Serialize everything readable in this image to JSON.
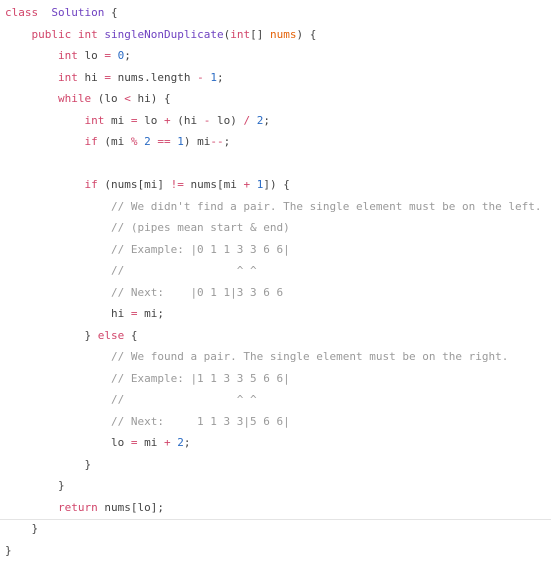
{
  "colors": {
    "keyword": "#d1456a",
    "type": "#6f42c1",
    "number": "#2a6bc4",
    "param": "#e36209",
    "comment": "#9a9a9a",
    "text": "#444444"
  },
  "code_lines": [
    [
      [
        "k",
        "class"
      ],
      [
        "",
        "  "
      ],
      [
        "t",
        "Solution"
      ],
      [
        "",
        " {"
      ]
    ],
    [
      [
        "",
        "    "
      ],
      [
        "k",
        "public"
      ],
      [
        "",
        " "
      ],
      [
        "k",
        "int"
      ],
      [
        "",
        " "
      ],
      [
        "t",
        "singleNonDuplicate"
      ],
      [
        "",
        "("
      ],
      [
        "k",
        "int"
      ],
      [
        "",
        "[] "
      ],
      [
        "p",
        "nums"
      ],
      [
        "",
        ") {"
      ]
    ],
    [
      [
        "",
        "        "
      ],
      [
        "k",
        "int"
      ],
      [
        "",
        " lo "
      ],
      [
        "o",
        "="
      ],
      [
        "",
        " "
      ],
      [
        "n",
        "0"
      ],
      [
        "",
        ";"
      ]
    ],
    [
      [
        "",
        "        "
      ],
      [
        "k",
        "int"
      ],
      [
        "",
        " hi "
      ],
      [
        "o",
        "="
      ],
      [
        "",
        " nums.length "
      ],
      [
        "o",
        "-"
      ],
      [
        "",
        " "
      ],
      [
        "n",
        "1"
      ],
      [
        "",
        ";"
      ]
    ],
    [
      [
        "",
        "        "
      ],
      [
        "k",
        "while"
      ],
      [
        "",
        " (lo "
      ],
      [
        "o",
        "<"
      ],
      [
        "",
        " hi) {"
      ]
    ],
    [
      [
        "",
        "            "
      ],
      [
        "k",
        "int"
      ],
      [
        "",
        " mi "
      ],
      [
        "o",
        "="
      ],
      [
        "",
        " lo "
      ],
      [
        "o",
        "+"
      ],
      [
        "",
        " (hi "
      ],
      [
        "o",
        "-"
      ],
      [
        "",
        " lo) "
      ],
      [
        "o",
        "/"
      ],
      [
        "",
        " "
      ],
      [
        "n",
        "2"
      ],
      [
        "",
        ";"
      ]
    ],
    [
      [
        "",
        "            "
      ],
      [
        "k",
        "if"
      ],
      [
        "",
        " (mi "
      ],
      [
        "o",
        "%"
      ],
      [
        "",
        " "
      ],
      [
        "n",
        "2"
      ],
      [
        "",
        " "
      ],
      [
        "o",
        "=="
      ],
      [
        "",
        " "
      ],
      [
        "n",
        "1"
      ],
      [
        "",
        ") mi"
      ],
      [
        "o",
        "--"
      ],
      [
        "",
        ";"
      ]
    ],
    [],
    [
      [
        "",
        "            "
      ],
      [
        "k",
        "if"
      ],
      [
        "",
        " (nums[mi] "
      ],
      [
        "o",
        "!="
      ],
      [
        "",
        " nums[mi "
      ],
      [
        "o",
        "+"
      ],
      [
        "",
        " "
      ],
      [
        "n",
        "1"
      ],
      [
        "",
        "]) {"
      ]
    ],
    [
      [
        "",
        "                "
      ],
      [
        "c",
        "// We didn't find a pair. The single element must be on the left."
      ]
    ],
    [
      [
        "",
        "                "
      ],
      [
        "c",
        "// (pipes mean start & end)"
      ]
    ],
    [
      [
        "",
        "                "
      ],
      [
        "c",
        "// Example: |0 1 1 3 3 6 6|"
      ]
    ],
    [
      [
        "",
        "                "
      ],
      [
        "c",
        "//                 ^ ^"
      ]
    ],
    [
      [
        "",
        "                "
      ],
      [
        "c",
        "// Next:    |0 1 1|3 3 6 6"
      ]
    ],
    [
      [
        "",
        "                "
      ],
      [
        "",
        "hi "
      ],
      [
        "o",
        "="
      ],
      [
        "",
        " mi;"
      ]
    ],
    [
      [
        "",
        "            "
      ],
      [
        "",
        "} "
      ],
      [
        "k",
        "else"
      ],
      [
        "",
        " {"
      ]
    ],
    [
      [
        "",
        "                "
      ],
      [
        "c",
        "// We found a pair. The single element must be on the right."
      ]
    ],
    [
      [
        "",
        "                "
      ],
      [
        "c",
        "// Example: |1 1 3 3 5 6 6|"
      ]
    ],
    [
      [
        "",
        "                "
      ],
      [
        "c",
        "//                 ^ ^"
      ]
    ],
    [
      [
        "",
        "                "
      ],
      [
        "c",
        "// Next:     1 1 3 3|5 6 6|"
      ]
    ],
    [
      [
        "",
        "                "
      ],
      [
        "",
        "lo "
      ],
      [
        "o",
        "="
      ],
      [
        "",
        " mi "
      ],
      [
        "o",
        "+"
      ],
      [
        "",
        " "
      ],
      [
        "n",
        "2"
      ],
      [
        "",
        ";"
      ]
    ],
    [
      [
        "",
        "            "
      ],
      [
        "",
        "}"
      ]
    ],
    [
      [
        "",
        "        "
      ],
      [
        "",
        "}"
      ]
    ],
    [
      [
        "",
        "        "
      ],
      [
        "k",
        "return"
      ],
      [
        "",
        " nums[lo];"
      ]
    ],
    [
      [
        "",
        "    "
      ],
      [
        "",
        "}"
      ]
    ],
    [
      [
        "",
        "}"
      ]
    ]
  ]
}
